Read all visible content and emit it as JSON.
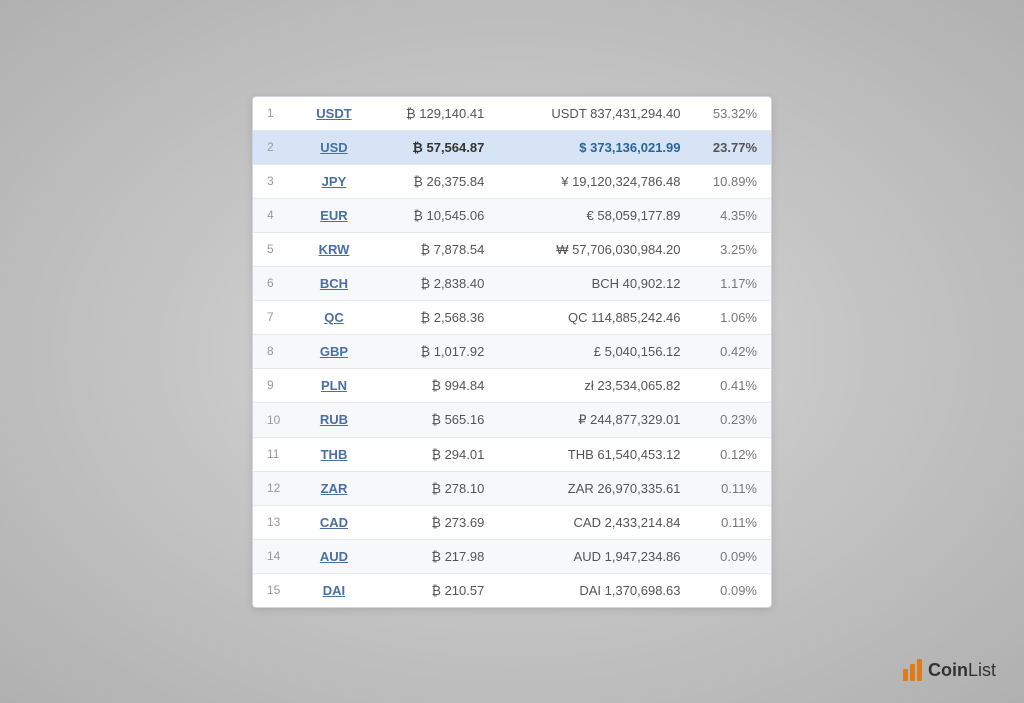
{
  "table": {
    "rows": [
      {
        "rank": 1,
        "currency": "USDT",
        "btc": "₿ 129,140.41",
        "fiat": "USDT 837,431,294.40",
        "percent": "53.32%",
        "highlighted": false
      },
      {
        "rank": 2,
        "currency": "USD",
        "btc": "₿ 57,564.87",
        "fiat": "$ 373,136,021.99",
        "percent": "23.77%",
        "highlighted": true
      },
      {
        "rank": 3,
        "currency": "JPY",
        "btc": "₿ 26,375.84",
        "fiat": "¥ 19,120,324,786.48",
        "percent": "10.89%",
        "highlighted": false
      },
      {
        "rank": 4,
        "currency": "EUR",
        "btc": "₿ 10,545.06",
        "fiat": "€ 58,059,177.89",
        "percent": "4.35%",
        "highlighted": false
      },
      {
        "rank": 5,
        "currency": "KRW",
        "btc": "₿ 7,878.54",
        "fiat": "₩ 57,706,030,984.20",
        "percent": "3.25%",
        "highlighted": false
      },
      {
        "rank": 6,
        "currency": "BCH",
        "btc": "₿ 2,838.40",
        "fiat": "BCH 40,902.12",
        "percent": "1.17%",
        "highlighted": false
      },
      {
        "rank": 7,
        "currency": "QC",
        "btc": "₿ 2,568.36",
        "fiat": "QC 114,885,242.46",
        "percent": "1.06%",
        "highlighted": false
      },
      {
        "rank": 8,
        "currency": "GBP",
        "btc": "₿ 1,017.92",
        "fiat": "£ 5,040,156.12",
        "percent": "0.42%",
        "highlighted": false
      },
      {
        "rank": 9,
        "currency": "PLN",
        "btc": "₿ 994.84",
        "fiat": "zł 23,534,065.82",
        "percent": "0.41%",
        "highlighted": false
      },
      {
        "rank": 10,
        "currency": "RUB",
        "btc": "₿ 565.16",
        "fiat": "₽ 244,877,329.01",
        "percent": "0.23%",
        "highlighted": false
      },
      {
        "rank": 11,
        "currency": "THB",
        "btc": "₿ 294.01",
        "fiat": "THB 61,540,453.12",
        "percent": "0.12%",
        "highlighted": false
      },
      {
        "rank": 12,
        "currency": "ZAR",
        "btc": "₿ 278.10",
        "fiat": "ZAR 26,970,335.61",
        "percent": "0.11%",
        "highlighted": false
      },
      {
        "rank": 13,
        "currency": "CAD",
        "btc": "₿ 273.69",
        "fiat": "CAD 2,433,214.84",
        "percent": "0.11%",
        "highlighted": false
      },
      {
        "rank": 14,
        "currency": "AUD",
        "btc": "₿ 217.98",
        "fiat": "AUD 1,947,234.86",
        "percent": "0.09%",
        "highlighted": false
      },
      {
        "rank": 15,
        "currency": "DAI",
        "btc": "₿ 210.57",
        "fiat": "DAI 1,370,698.63",
        "percent": "0.09%",
        "highlighted": false
      }
    ]
  },
  "logo": {
    "text": "CoinList"
  }
}
